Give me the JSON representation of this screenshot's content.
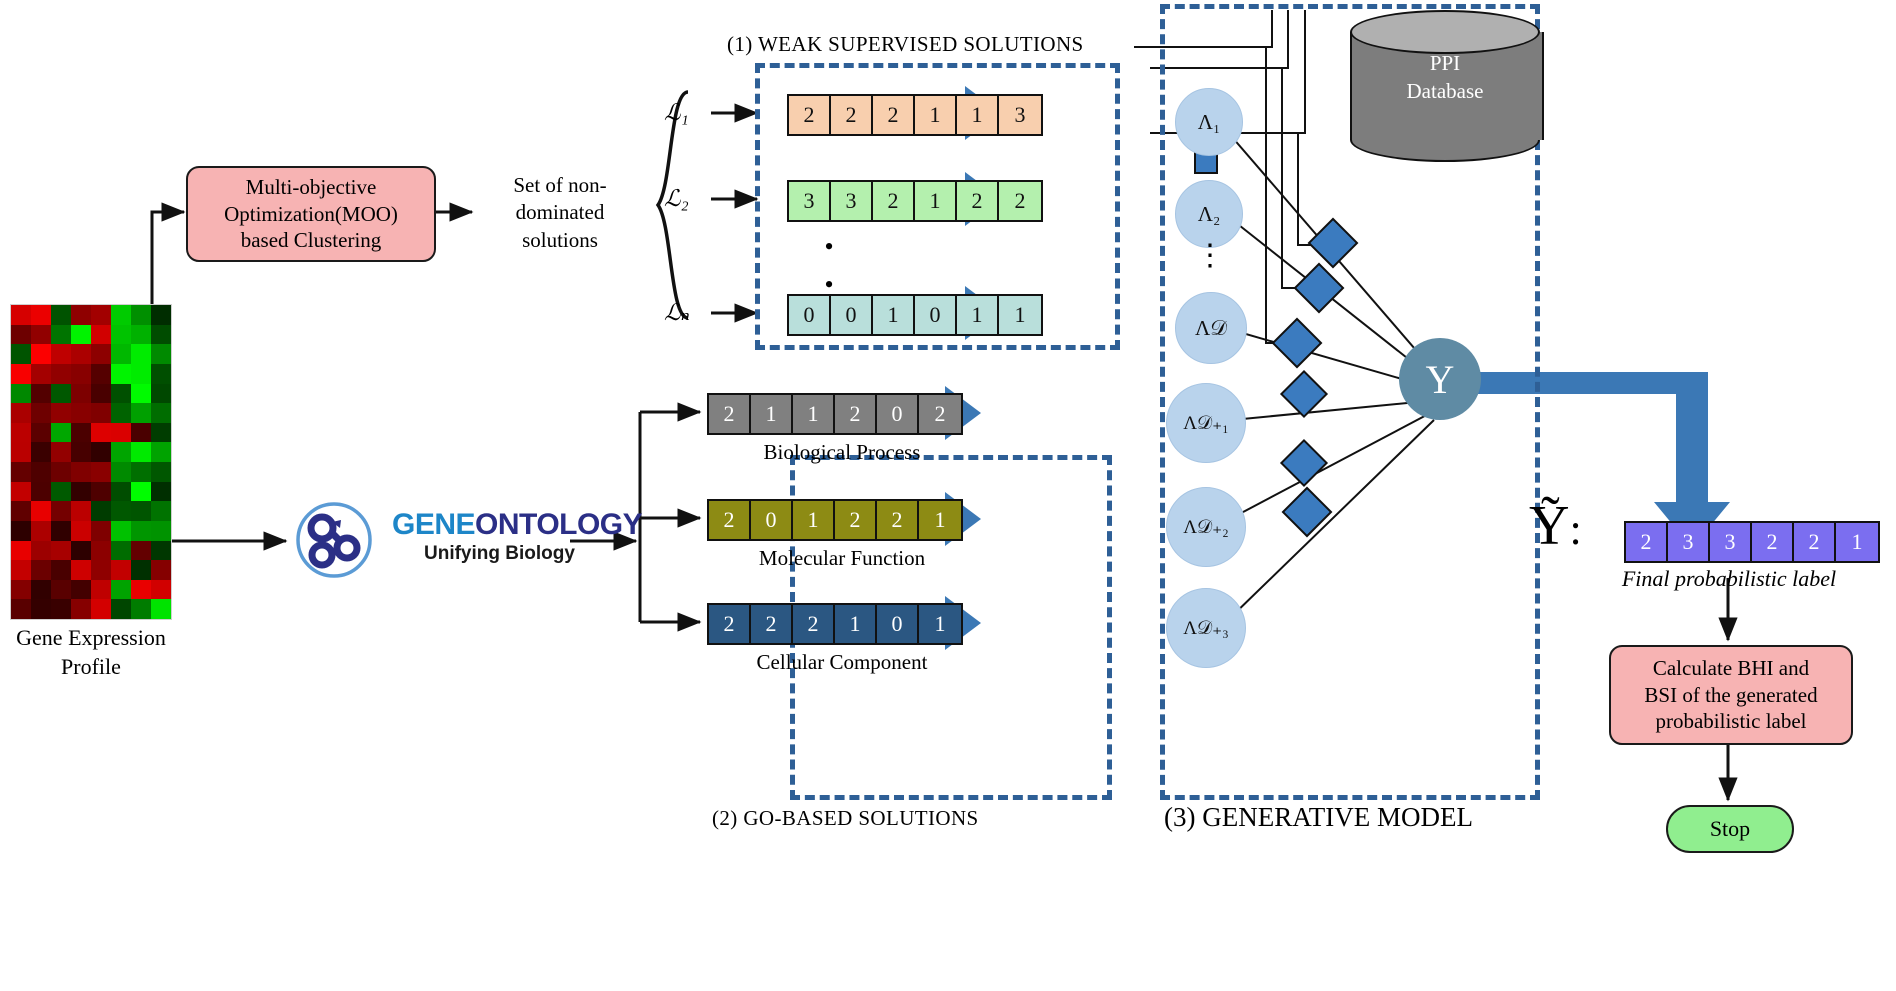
{
  "sections": {
    "weak_supervised": {
      "caption": "(1) WEAK SUPERVISED SOLUTIONS"
    },
    "go_based": {
      "caption": "(2) GO-BASED SOLUTIONS"
    },
    "generative": {
      "caption": "(3) GENERATIVE MODEL"
    }
  },
  "input": {
    "heatmap_label_line1": "Gene Expression",
    "heatmap_label_line2": "Profile"
  },
  "moo": {
    "line1": "Multi-objective",
    "line2": "Optimization(MOO)",
    "line3": "based Clustering"
  },
  "nondominated": {
    "line1": "Set of non-",
    "line2": "dominated",
    "line3": "solutions"
  },
  "gene_ontology": {
    "word1": "GENE",
    "word2": "ONTOLOGY",
    "tagline": "Unifying Biology",
    "color1": "#1d86c8",
    "color2": "#2b2f86"
  },
  "weak_vectors": [
    {
      "name": "ℒ₁",
      "values": [
        "2",
        "2",
        "2",
        "1",
        "1",
        "3"
      ],
      "fill": "#f8cfae",
      "text": "#111111"
    },
    {
      "name": "ℒ₂",
      "values": [
        "3",
        "3",
        "2",
        "1",
        "2",
        "2"
      ],
      "fill": "#b4f0ae",
      "text": "#111111"
    },
    {
      "name": "ℒₙ",
      "values": [
        "0",
        "0",
        "1",
        "0",
        "1",
        "1"
      ],
      "fill": "#b9dfdb",
      "text": "#111111"
    }
  ],
  "go_vectors": [
    {
      "values": [
        "2",
        "1",
        "1",
        "2",
        "0",
        "2"
      ],
      "label": "Biological Process",
      "fill": "#808080",
      "text": "#ffffff"
    },
    {
      "values": [
        "2",
        "0",
        "1",
        "2",
        "2",
        "1"
      ],
      "label": "Molecular Function",
      "fill": "#8d8b14",
      "text": "#ffffff"
    },
    {
      "values": [
        "2",
        "2",
        "2",
        "1",
        "0",
        "1"
      ],
      "label": "Cellular Component",
      "fill": "#2b5782",
      "text": "#ffffff"
    }
  ],
  "lambda_nodes": [
    {
      "label": "Λ₁"
    },
    {
      "label": "Λ𝒟"
    },
    {
      "label": "Λ₂"
    },
    {
      "label": "Λ𝒟₊₁"
    },
    {
      "label": "Λ𝒟₊₂"
    },
    {
      "label": "Λ𝒟₊₃"
    }
  ],
  "lambda_labels": {
    "n1": "Λ₁",
    "n2": "Λ₂",
    "ellipsis": "⋮",
    "nD": "Λ𝒟",
    "nD1": "Λ𝒟₊₁",
    "nD2": "Λ𝒟₊₂",
    "nD3": "Λ𝒟₊₃"
  },
  "y_node": {
    "label": "Y",
    "color": "#5f8ba4"
  },
  "ppi": {
    "line1": "PPI",
    "line2": "Database",
    "color": "#7d7d7d"
  },
  "output": {
    "symbol": "Ỹ",
    "colon": ":",
    "values": [
      "2",
      "3",
      "3",
      "2",
      "2",
      "1"
    ],
    "fill": "#7b6ef0",
    "caption": "Final probabilistic label"
  },
  "bhi_box": {
    "line1": "Calculate BHI and",
    "line2": "BSI of the generated",
    "line3": "probabilistic label"
  },
  "stop": {
    "label": "Stop"
  },
  "dots": {
    "vertical": "•"
  },
  "colors": {
    "dashed_border": "#2e5f96",
    "arrow_blue": "#3b78b5",
    "node_blue": "#b9d3ec",
    "diamond": "#3b7bbf",
    "pink": "#f7b3b3",
    "green": "#90ee8f"
  }
}
